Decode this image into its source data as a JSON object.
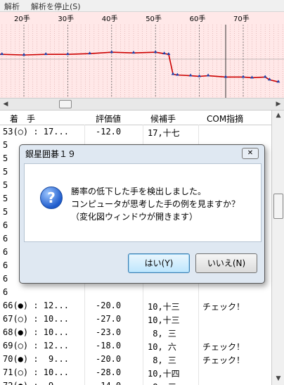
{
  "menu": {
    "items": [
      "解析",
      "解析を停止(S)"
    ]
  },
  "chart": {
    "x_ticks": [
      "20手",
      "30手",
      "40手",
      "50手",
      "60手",
      "70手"
    ],
    "ticks_moves": [
      20,
      30,
      40,
      50,
      60,
      70
    ],
    "current_move": 66,
    "series": [
      [
        1,
        0.43
      ],
      [
        5,
        0.42
      ],
      [
        10,
        0.42
      ],
      [
        15,
        0.43
      ],
      [
        20,
        0.44
      ],
      [
        25,
        0.43
      ],
      [
        30,
        0.43
      ],
      [
        35,
        0.42
      ],
      [
        40,
        0.4
      ],
      [
        45,
        0.41
      ],
      [
        50,
        0.4
      ],
      [
        52,
        0.42
      ],
      [
        53,
        0.43
      ],
      [
        54,
        0.72
      ],
      [
        55,
        0.73
      ],
      [
        58,
        0.74
      ],
      [
        60,
        0.75
      ],
      [
        62,
        0.74
      ],
      [
        66,
        0.76
      ],
      [
        70,
        0.76
      ],
      [
        72,
        0.77
      ],
      [
        75,
        0.76
      ],
      [
        76,
        0.8
      ],
      [
        78,
        0.83
      ]
    ]
  },
  "table": {
    "headers": {
      "move": "着　手",
      "eval": "評価値",
      "cand": "候補手",
      "com": "COM指摘"
    },
    "rows": [
      {
        "move": "53(○) : 17...",
        "eval": "-12.0",
        "cand": "17,十七",
        "com": ""
      },
      {
        "move": "5",
        "eval": "",
        "cand": "",
        "com": ""
      },
      {
        "move": "5",
        "eval": "",
        "cand": "",
        "com": ""
      },
      {
        "move": "5",
        "eval": "",
        "cand": "",
        "com": ""
      },
      {
        "move": "5",
        "eval": "",
        "cand": "",
        "com": ""
      },
      {
        "move": "5",
        "eval": "",
        "cand": "",
        "com": ""
      },
      {
        "move": "5",
        "eval": "",
        "cand": "",
        "com": ""
      },
      {
        "move": "6",
        "eval": "",
        "cand": "",
        "com": ""
      },
      {
        "move": "6",
        "eval": "",
        "cand": "",
        "com": ""
      },
      {
        "move": "6",
        "eval": "",
        "cand": "",
        "com": ""
      },
      {
        "move": "6",
        "eval": "",
        "cand": "",
        "com": ""
      },
      {
        "move": "6",
        "eval": "",
        "cand": "",
        "com": ""
      },
      {
        "move": "6",
        "eval": "",
        "cand": "",
        "com": ""
      },
      {
        "move": "66(●) : 12...",
        "eval": "-20.0",
        "cand": "10,十三",
        "com": "チェック！"
      },
      {
        "move": "67(○) : 10...",
        "eval": "-27.0",
        "cand": "10,十三",
        "com": ""
      },
      {
        "move": "68(●) : 10...",
        "eval": "-23.0",
        "cand": " 8, 三",
        "com": ""
      },
      {
        "move": "69(○) : 12...",
        "eval": "-18.0",
        "cand": "10, 六",
        "com": "チェック！"
      },
      {
        "move": "70(●) :  9...",
        "eval": "-20.0",
        "cand": " 8, 三",
        "com": "チェック！"
      },
      {
        "move": "71(○) : 10...",
        "eval": "-28.0",
        "cand": "10,十四",
        "com": ""
      },
      {
        "move": "72(●) :  9...",
        "eval": "-14.0",
        "cand": " 8, 三",
        "com": ""
      }
    ]
  },
  "dialog": {
    "title": "銀星囲碁１９",
    "close_label": "✕",
    "icon": "question-icon",
    "message_lines": [
      "勝率の低下した手を検出しました。",
      "コンピュータが思考した手の例を見ますか？",
      "（変化図ウィンドウが開きます）"
    ],
    "yes_label": "はい(Y)",
    "no_label": "いいえ(N)"
  },
  "colors": {
    "series_line": "#cc0000",
    "marker": "#1f3fa8",
    "chart_bg": "#ffe8e8",
    "dialog_bg": "#dfe8f2"
  }
}
